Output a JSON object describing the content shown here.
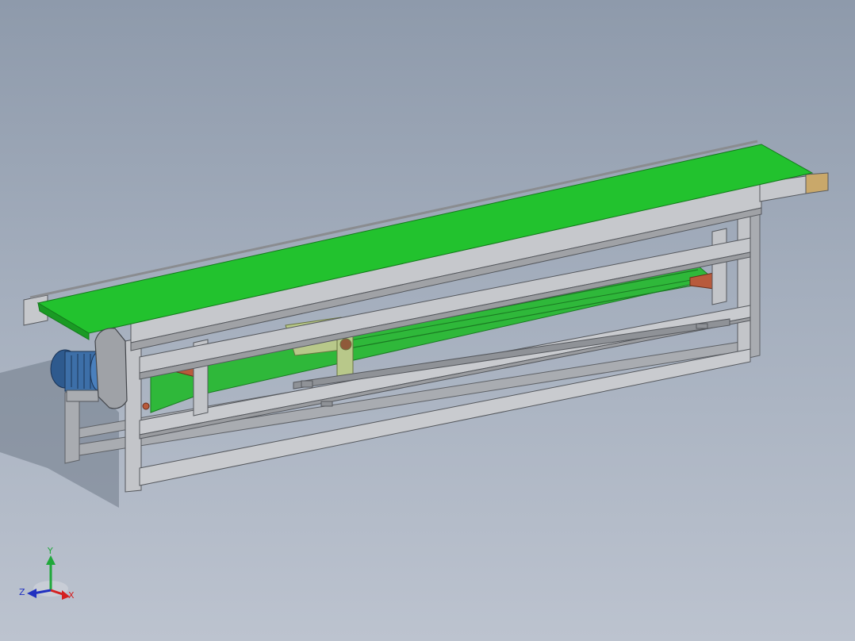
{
  "viewport": {
    "background_top": "#8e9aab",
    "background_bottom": "#bcc3cf"
  },
  "model": {
    "belt_color": "#22c22e",
    "return_belt_color": "#2fb83a",
    "frame_color": "#b4b6ba",
    "motor_color": "#3d6fa8",
    "roller_end_color": "#b85a3c",
    "bracket_color": "#b8c88a"
  },
  "triad": {
    "x_label": "X",
    "y_label": "Y",
    "z_label": "Z",
    "x_color": "#d42020",
    "y_color": "#1fa83a",
    "z_color": "#2030c0"
  }
}
